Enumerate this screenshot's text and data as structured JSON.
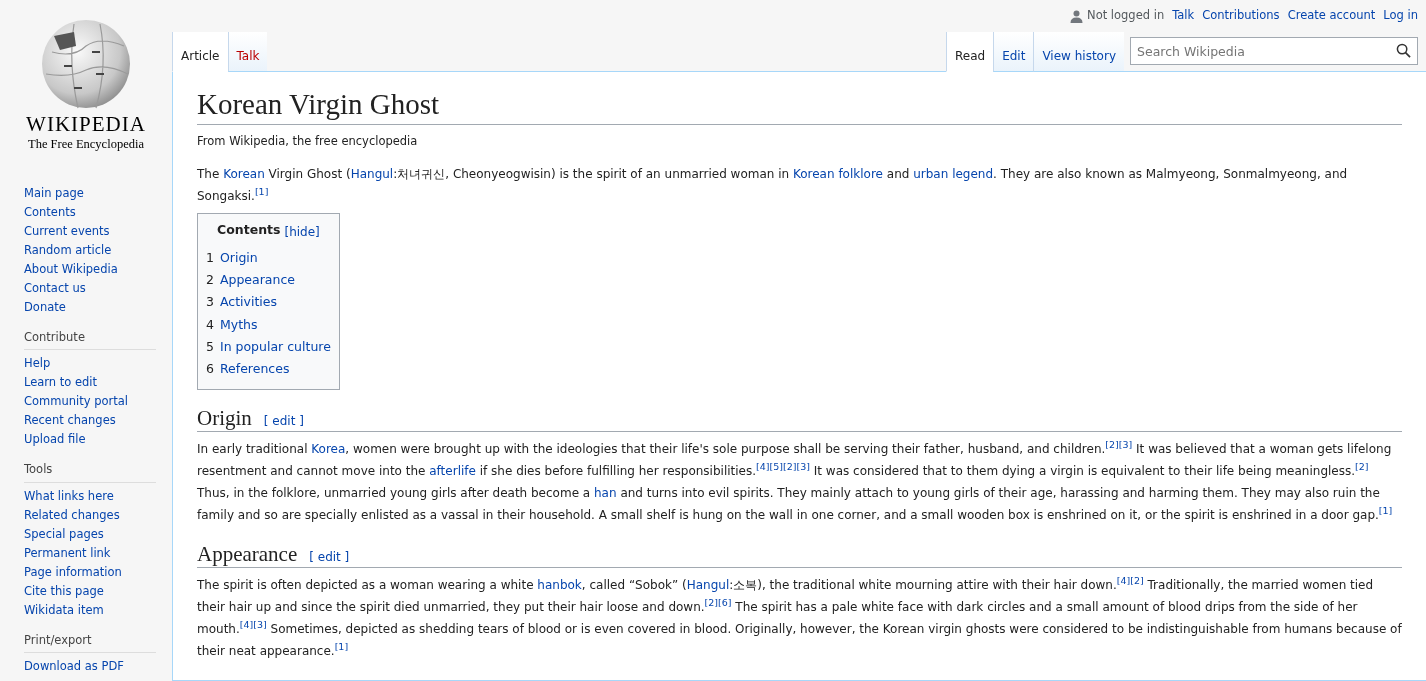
{
  "logo": {
    "wordmark": "WIKIPEDIA",
    "tagline": "The Free Encyclopedia"
  },
  "personal_tools": {
    "status": "Not logged in",
    "links": [
      "Talk",
      "Contributions",
      "Create account",
      "Log in"
    ]
  },
  "left_tabs": [
    {
      "label": "Article",
      "selected": true,
      "missing": false
    },
    {
      "label": "Talk",
      "selected": false,
      "missing": true
    }
  ],
  "right_tabs": [
    {
      "label": "Read",
      "selected": true,
      "missing": false
    },
    {
      "label": "Edit",
      "selected": false,
      "missing": false
    },
    {
      "label": "View history",
      "selected": false,
      "missing": false
    }
  ],
  "search": {
    "placeholder": "Search Wikipedia"
  },
  "sidebar": [
    {
      "items": [
        "Main page",
        "Contents",
        "Current events",
        "Random article",
        "About Wikipedia",
        "Contact us",
        "Donate"
      ]
    },
    {
      "heading": "Contribute",
      "items": [
        "Help",
        "Learn to edit",
        "Community portal",
        "Recent changes",
        "Upload file"
      ]
    },
    {
      "heading": "Tools",
      "items": [
        "What links here",
        "Related changes",
        "Special pages",
        "Permanent link",
        "Page information",
        "Cite this page",
        "Wikidata item"
      ]
    },
    {
      "heading": "Print/export",
      "items": [
        "Download as PDF"
      ]
    }
  ],
  "article": {
    "title": "Korean Virgin Ghost",
    "tagline": "From Wikipedia, the free encyclopedia",
    "intro": [
      {
        "kind": "text",
        "text": "The "
      },
      {
        "kind": "link",
        "text": "Korean"
      },
      {
        "kind": "text",
        "text": " Virgin Ghost ("
      },
      {
        "kind": "link",
        "text": "Hangul"
      },
      {
        "kind": "text",
        "text": ":처녀귀신, Cheonyeogwisin) is the spirit of an unmarried woman in "
      },
      {
        "kind": "link",
        "text": "Korean folklore"
      },
      {
        "kind": "text",
        "text": " and "
      },
      {
        "kind": "link",
        "text": "urban legend"
      },
      {
        "kind": "text",
        "text": ". They are also known as Malmyeong, Sonmalmyeong, and Songaksi."
      },
      {
        "kind": "ref",
        "text": "[1]"
      }
    ],
    "toc": {
      "title": "Contents",
      "toggle": "[hide]",
      "items": [
        {
          "number": "1",
          "label": "Origin"
        },
        {
          "number": "2",
          "label": "Appearance"
        },
        {
          "number": "3",
          "label": "Activities"
        },
        {
          "number": "4",
          "label": "Myths"
        },
        {
          "number": "5",
          "label": "In popular culture"
        },
        {
          "number": "6",
          "label": "References"
        }
      ]
    },
    "sections": [
      {
        "heading": "Origin",
        "edit": "[ edit ]",
        "paragraph": [
          {
            "kind": "text",
            "text": "In early traditional "
          },
          {
            "kind": "link",
            "text": "Korea"
          },
          {
            "kind": "text",
            "text": ", women were brought up with the ideologies that their life's sole purpose shall be serving their father, husband, and children."
          },
          {
            "kind": "ref",
            "text": "[2]"
          },
          {
            "kind": "ref",
            "text": "[3]"
          },
          {
            "kind": "text",
            "text": " It was believed that a woman gets lifelong resentment and cannot move into the "
          },
          {
            "kind": "link",
            "text": "afterlife"
          },
          {
            "kind": "text",
            "text": " if she dies before fulfilling her responsibilities."
          },
          {
            "kind": "ref",
            "text": "[4]"
          },
          {
            "kind": "ref",
            "text": "[5]"
          },
          {
            "kind": "ref",
            "text": "[2]"
          },
          {
            "kind": "ref",
            "text": "[3]"
          },
          {
            "kind": "text",
            "text": " It was considered that to them dying a virgin is equivalent to their life being meaningless."
          },
          {
            "kind": "ref",
            "text": "[2]"
          },
          {
            "kind": "text",
            "text": " Thus, in the folklore, unmarried young girls after death become a "
          },
          {
            "kind": "link",
            "text": "han"
          },
          {
            "kind": "text",
            "text": " and turns into evil spirits. They mainly attach to young girls of their age, harassing and harming them. They may also ruin the family and so are specially enlisted as a vassal in their household. A small shelf is hung on the wall in one corner, and a small wooden box is enshrined on it, or the spirit is enshrined in a door gap."
          },
          {
            "kind": "ref",
            "text": "[1]"
          }
        ]
      },
      {
        "heading": "Appearance",
        "edit": "[ edit ]",
        "paragraph": [
          {
            "kind": "text",
            "text": "The spirit is often depicted as a woman wearing a white "
          },
          {
            "kind": "link",
            "text": "hanbok"
          },
          {
            "kind": "text",
            "text": ", called “Sobok” ("
          },
          {
            "kind": "link",
            "text": "Hangul"
          },
          {
            "kind": "text",
            "text": ":소복), the traditional white mourning attire with their hair down."
          },
          {
            "kind": "ref",
            "text": "[4]"
          },
          {
            "kind": "ref",
            "text": "[2]"
          },
          {
            "kind": "text",
            "text": " Traditionally, the married women tied their hair up and since the spirit died unmarried, they put their hair loose and down."
          },
          {
            "kind": "ref",
            "text": "[2]"
          },
          {
            "kind": "ref",
            "text": "[6]"
          },
          {
            "kind": "text",
            "text": " The spirit has a pale white face with dark circles and a small amount of blood drips from the side of her mouth."
          },
          {
            "kind": "ref",
            "text": "[4]"
          },
          {
            "kind": "ref",
            "text": "[3]"
          },
          {
            "kind": "text",
            "text": " Sometimes, depicted as shedding tears of blood or is even covered in blood. Originally, however, the Korean virgin ghosts were considered to be indistinguishable from humans because of their neat appearance."
          },
          {
            "kind": "ref",
            "text": "[1]"
          }
        ]
      }
    ]
  }
}
